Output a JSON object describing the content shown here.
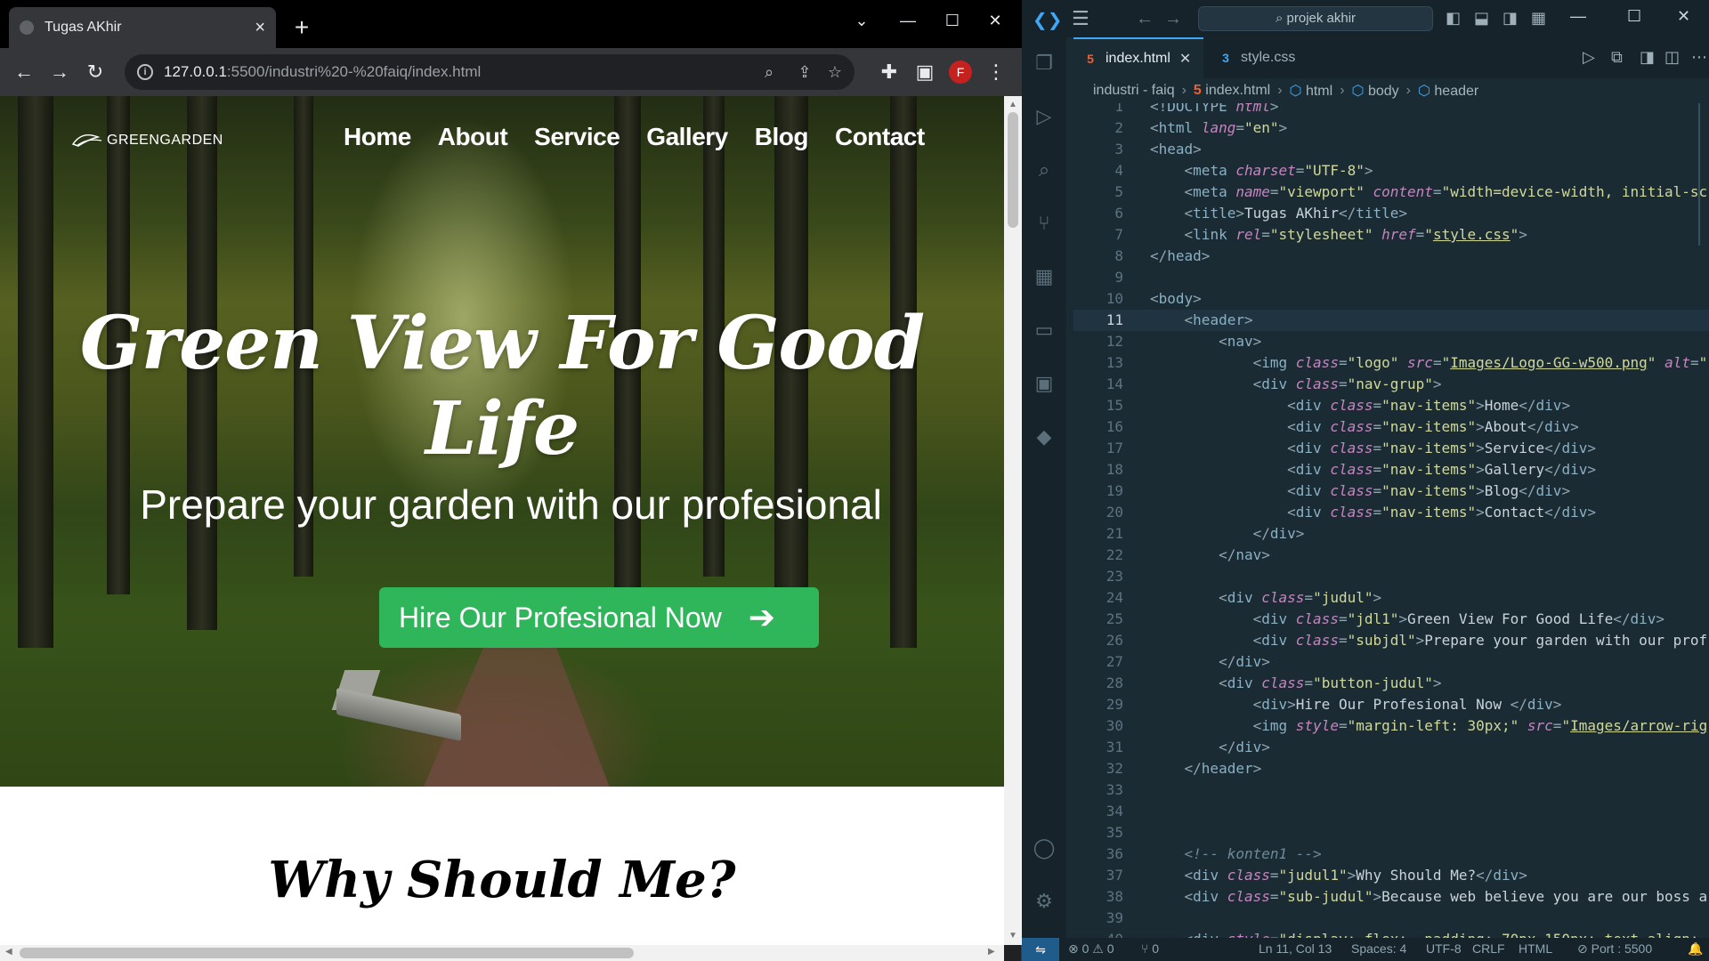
{
  "browser": {
    "tab_title": "Tugas AKhir",
    "url_host": "127.0.0.1",
    "url_path": ":5500/industri%20-%20faiq/index.html",
    "profile_initial": "F"
  },
  "site": {
    "logo_text": "GREENGARDEN",
    "nav": [
      "Home",
      "About",
      "Service",
      "Gallery",
      "Blog",
      "Contact"
    ],
    "title": "Green View For Good Life",
    "subtitle": "Prepare your garden with our profesional",
    "cta": "Hire Our Profesional Now",
    "section_title": "Why Should Me?"
  },
  "vscode": {
    "search": "projek akhir",
    "tabs": [
      "index.html",
      "style.css"
    ],
    "breadcrumbs": [
      "industri - faiq",
      "index.html",
      "html",
      "body",
      "header"
    ],
    "status": {
      "errors": "0",
      "warnings": "0",
      "ports": "0",
      "position": "Ln 11, Col 13",
      "spaces": "Spaces: 4",
      "encoding": "UTF-8",
      "eol": "CRLF",
      "language": "HTML",
      "port": "Port : 5500"
    },
    "current_line": 11
  },
  "colors": {
    "cta_green": "#2fb65a",
    "vscode_bg": "#1b2b34",
    "accent_blue": "#3fa7f5"
  }
}
